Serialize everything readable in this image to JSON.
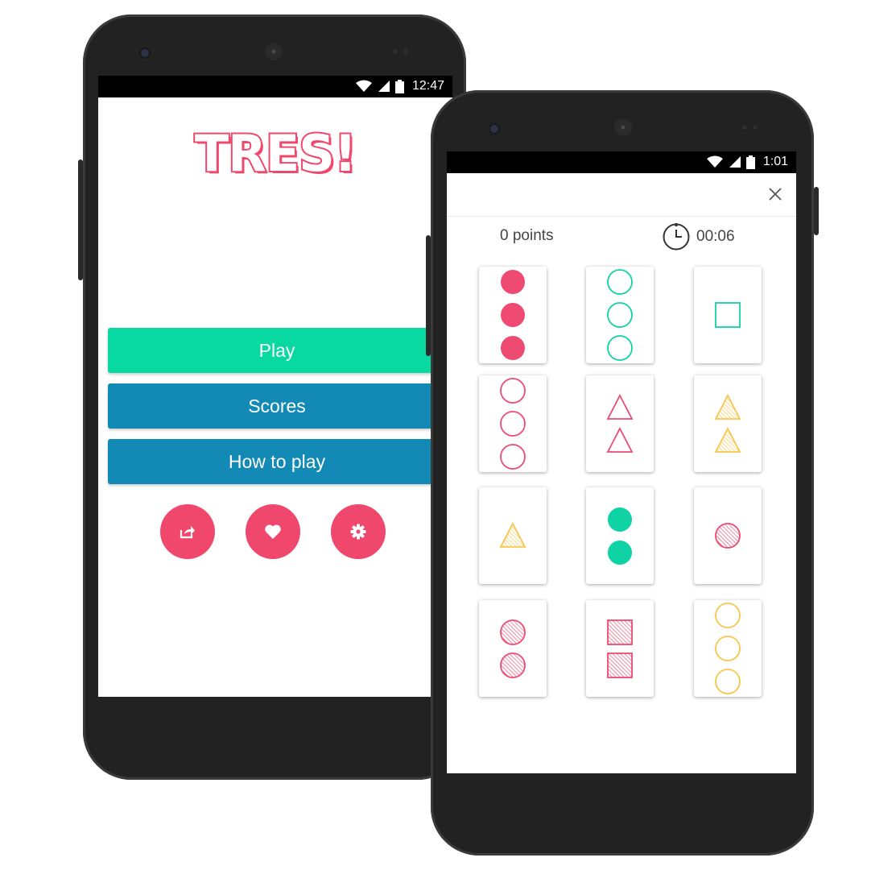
{
  "phone1": {
    "status_time": "12:47",
    "logo_text": "TRES!",
    "buttons": {
      "play": "Play",
      "scores": "Scores",
      "how_to_play": "How to play"
    },
    "icons": [
      "share-icon",
      "heart-icon",
      "gear-icon"
    ]
  },
  "phone2": {
    "status_time": "1:01",
    "points_text": "0 points",
    "timer_text": "00:06",
    "cards": [
      {
        "count": 3,
        "shape": "circle",
        "fill": "solid",
        "color": "red"
      },
      {
        "count": 3,
        "shape": "circle",
        "fill": "outline",
        "color": "green"
      },
      {
        "count": 1,
        "shape": "square",
        "fill": "outline",
        "color": "green"
      },
      {
        "count": 3,
        "shape": "circle",
        "fill": "outline",
        "color": "red"
      },
      {
        "count": 2,
        "shape": "triangle",
        "fill": "outline",
        "color": "red"
      },
      {
        "count": 2,
        "shape": "triangle",
        "fill": "striped",
        "color": "yellow"
      },
      {
        "count": 1,
        "shape": "triangle",
        "fill": "striped",
        "color": "yellow"
      },
      {
        "count": 2,
        "shape": "circle",
        "fill": "solid",
        "color": "green"
      },
      {
        "count": 1,
        "shape": "circle",
        "fill": "striped",
        "color": "red"
      },
      {
        "count": 2,
        "shape": "circle",
        "fill": "striped",
        "color": "red"
      },
      {
        "count": 2,
        "shape": "square",
        "fill": "striped",
        "color": "red"
      },
      {
        "count": 3,
        "shape": "circle",
        "fill": "outline",
        "color": "yellow"
      }
    ]
  },
  "colors": {
    "accent_pink": "#f0476d",
    "play_green": "#07d9a0",
    "menu_blue": "#1389b5",
    "card_red": "#ee4a72",
    "card_green": "#0fd3a5",
    "card_yellow": "#f7c64b"
  }
}
